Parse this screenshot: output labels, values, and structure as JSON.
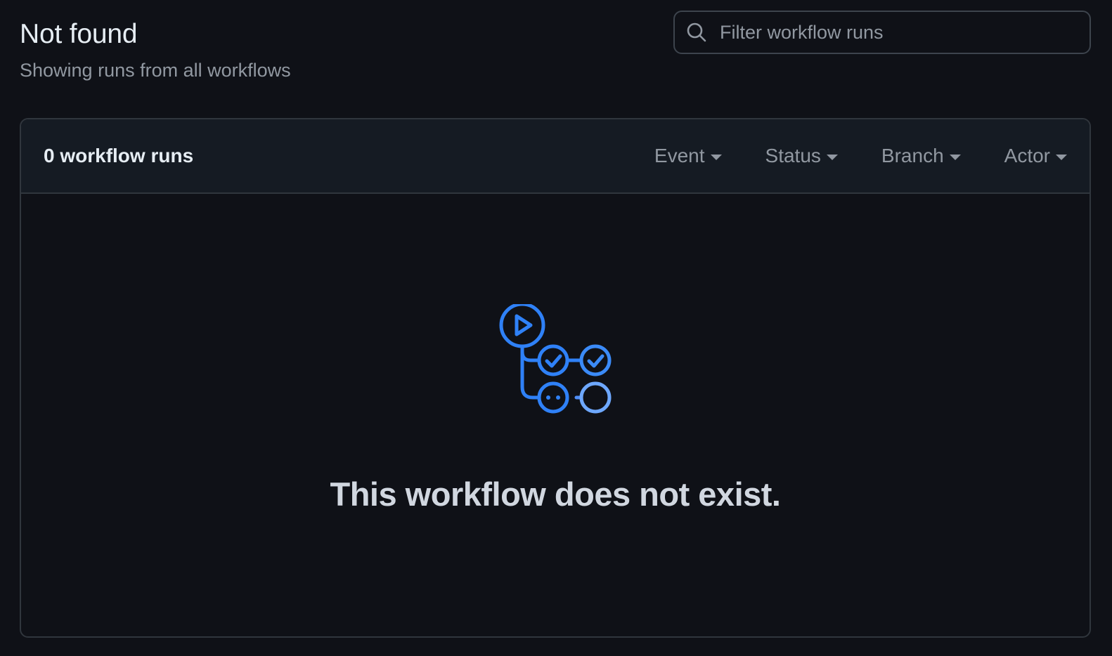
{
  "header": {
    "title": "Not found",
    "subtitle": "Showing runs from all workflows"
  },
  "search": {
    "placeholder": "Filter workflow runs",
    "value": "",
    "icon": "search-icon"
  },
  "runs_box": {
    "count_label": "0 workflow runs",
    "filters": [
      {
        "label": "Event",
        "icon": "caret-down-icon"
      },
      {
        "label": "Status",
        "icon": "caret-down-icon"
      },
      {
        "label": "Branch",
        "icon": "caret-down-icon"
      },
      {
        "label": "Actor",
        "icon": "caret-down-icon"
      }
    ]
  },
  "empty_state": {
    "icon": "workflow-illustration-icon",
    "message": "This workflow does not exist."
  },
  "colors": {
    "background": "#0f1117",
    "header_bg": "#151b23",
    "border": "#30363d",
    "accent_blue": "#2f81f7",
    "accent_blue_light": "#6ea8fe",
    "muted_text": "#9198a1"
  }
}
